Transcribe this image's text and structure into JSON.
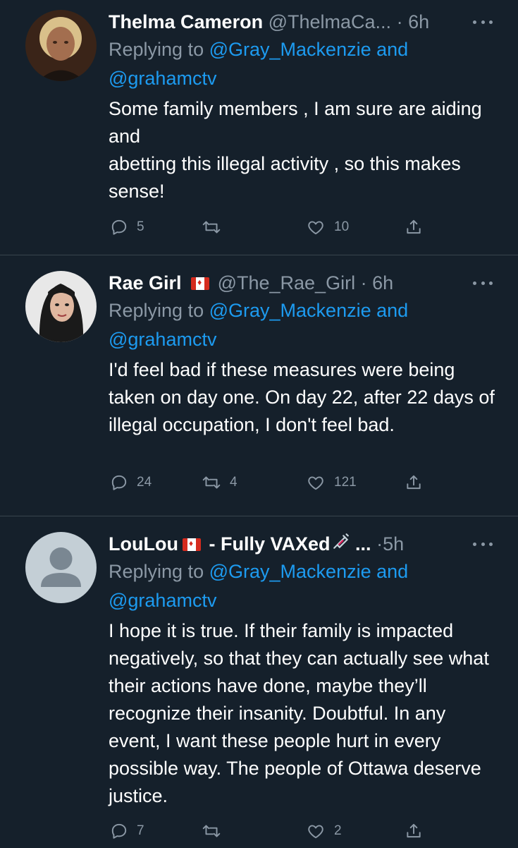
{
  "tweets": [
    {
      "name": "Thelma Cameron",
      "handle": "@ThelmaCa...",
      "time": "6h",
      "replying_prefix": "Replying to",
      "mention1": "@Gray_Mackenzie",
      "and": "and",
      "mention2": "@grahamctv",
      "text": "Some family members , I am sure are aiding and\nabetting this illegal activity , so this makes sense!",
      "replies": "5",
      "retweets": "",
      "likes": "10",
      "avatar": "photo-woman-blonde"
    },
    {
      "name": "Rae Girl",
      "handle": "@The_Rae_Girl",
      "time": "6h",
      "replying_prefix": "Replying to",
      "mention1": "@Gray_Mackenzie",
      "and": "and",
      "mention2": "@grahamctv",
      "text": "I'd feel bad if these measures were being taken on day one. On day 22, after 22 days of illegal occupation, I don't feel bad.",
      "replies": "24",
      "retweets": "4",
      "likes": "121",
      "avatar": "photo-woman-dark-hair"
    },
    {
      "name": "LouLou",
      "name_suffix": "- Fully VAXed",
      "ellipsis": "...",
      "time": "5h",
      "replying_prefix": "Replying to",
      "mention1": "@Gray_Mackenzie",
      "and": "and",
      "mention2": "@grahamctv",
      "text": "I hope it is true. If their family is impacted negatively, so that they can actually see what their actions have done, maybe they’ll recognize their insanity. Doubtful. In any event, I want these people hurt in every possible way. The people of Ottawa deserve justice.",
      "replies": "7",
      "retweets": "",
      "likes": "2",
      "avatar": "default-avatar"
    }
  ],
  "separator": "·",
  "icons": {
    "reply": "reply-icon",
    "retweet": "retweet-icon",
    "like": "like-icon",
    "share": "share-icon",
    "more": "more-icon",
    "flag": "canada-flag-icon",
    "syringe": "syringe-icon"
  },
  "colors": {
    "background": "#15202b",
    "text": "#ffffff",
    "secondary": "#8b98a5",
    "link": "#1d9bf0",
    "divider": "#38444d"
  }
}
